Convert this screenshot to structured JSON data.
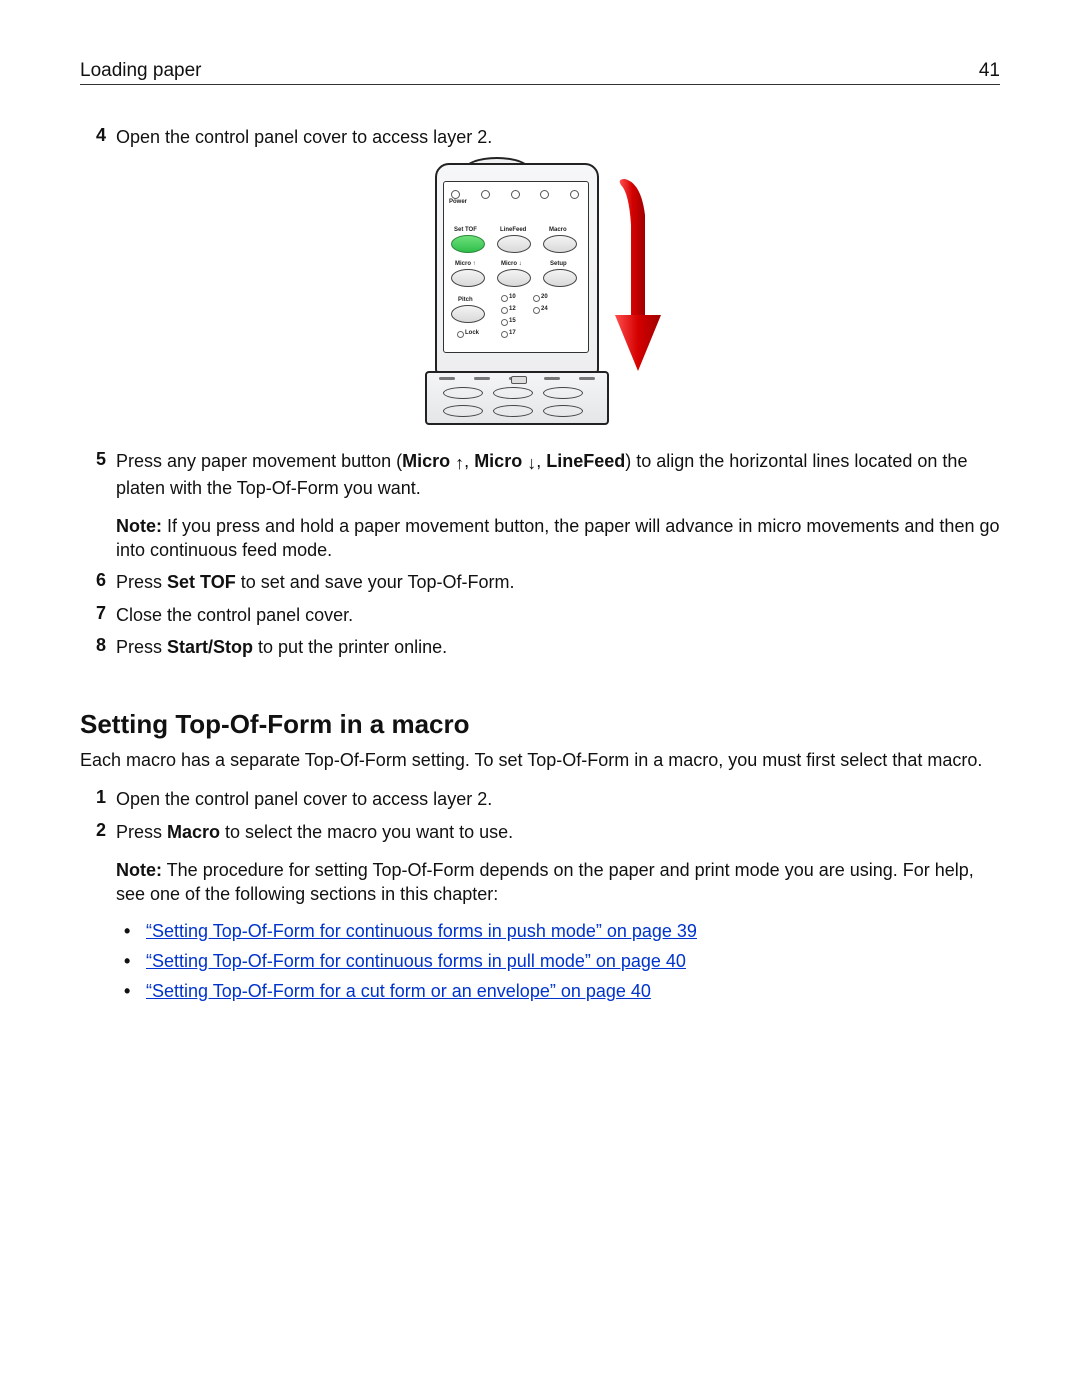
{
  "header": {
    "title": "Loading paper",
    "page_number": "41"
  },
  "steps_a": [
    {
      "num": "4",
      "text": "Open the control panel cover to access layer 2."
    }
  ],
  "panel": {
    "power_label": "Power",
    "row1_labels": [
      "Set TOF",
      "LineFeed",
      "Macro"
    ],
    "row2_labels": [
      "Micro ↑",
      "Micro ↓",
      "Setup"
    ],
    "pitch_label": "Pitch",
    "pitch_values": [
      "10",
      "20",
      "12",
      "24",
      "15",
      "17"
    ],
    "lock_label": "Lock"
  },
  "step5": {
    "num": "5",
    "pre": "Press any paper movement button (",
    "b1": "Micro ",
    "b2": "Micro ",
    "b3": "LineFeed",
    "post": ") to align the horizontal lines located on the platen with the Top‑Of‑Form you want.",
    "note_label": "Note:",
    "note_text": " If you press and hold a paper movement button, the paper will advance in micro movements and then go into continuous feed mode."
  },
  "step6": {
    "num": "6",
    "pre": "Press ",
    "bold": "Set TOF",
    "post": " to set and save your Top‑Of‑Form."
  },
  "step7": {
    "num": "7",
    "text": "Close the control panel cover."
  },
  "step8": {
    "num": "8",
    "pre": "Press ",
    "bold": "Start/Stop",
    "post": " to put the printer online."
  },
  "section_heading": "Setting Top‑Of‑Form in a macro",
  "section_intro": "Each macro has a separate Top‑Of‑Form setting. To set Top‑Of‑Form in a macro, you must first select that macro.",
  "macro_step1": {
    "num": "1",
    "text": "Open the control panel cover to access layer 2."
  },
  "macro_step2": {
    "num": "2",
    "pre": "Press ",
    "bold": "Macro",
    "post": " to select the macro you want to use.",
    "note_label": "Note:",
    "note_text": " The procedure for setting Top‑Of‑Form depends on the paper and print mode you are using. For help, see one of the following sections in this chapter:"
  },
  "links": [
    "“Setting Top‑Of‑Form for continuous forms in push mode” on page 39",
    "“Setting Top‑Of‑Form for continuous forms in pull mode” on page 40",
    "“Setting Top‑Of‑Form for a cut form or an envelope” on page 40"
  ]
}
